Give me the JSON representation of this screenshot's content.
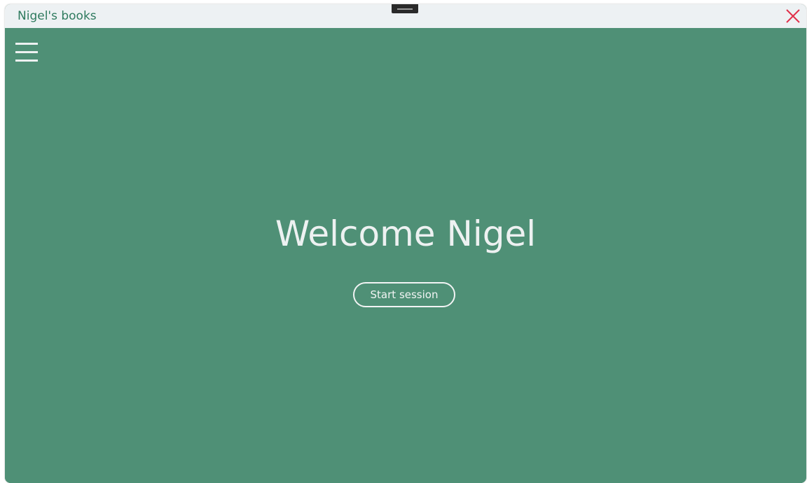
{
  "window": {
    "title": "Nigel's books"
  },
  "titlebar": {
    "close_icon": "close-icon"
  },
  "nav": {
    "menu_icon": "hamburger-menu-icon"
  },
  "main": {
    "heading": "Welcome Nigel",
    "start_button_label": "Start session"
  },
  "colors": {
    "background": "#4f9076",
    "titlebar": "#edf1f3",
    "title_text": "#2e7a5e",
    "close": "#e0304a",
    "foreground": "#edf1f1"
  }
}
